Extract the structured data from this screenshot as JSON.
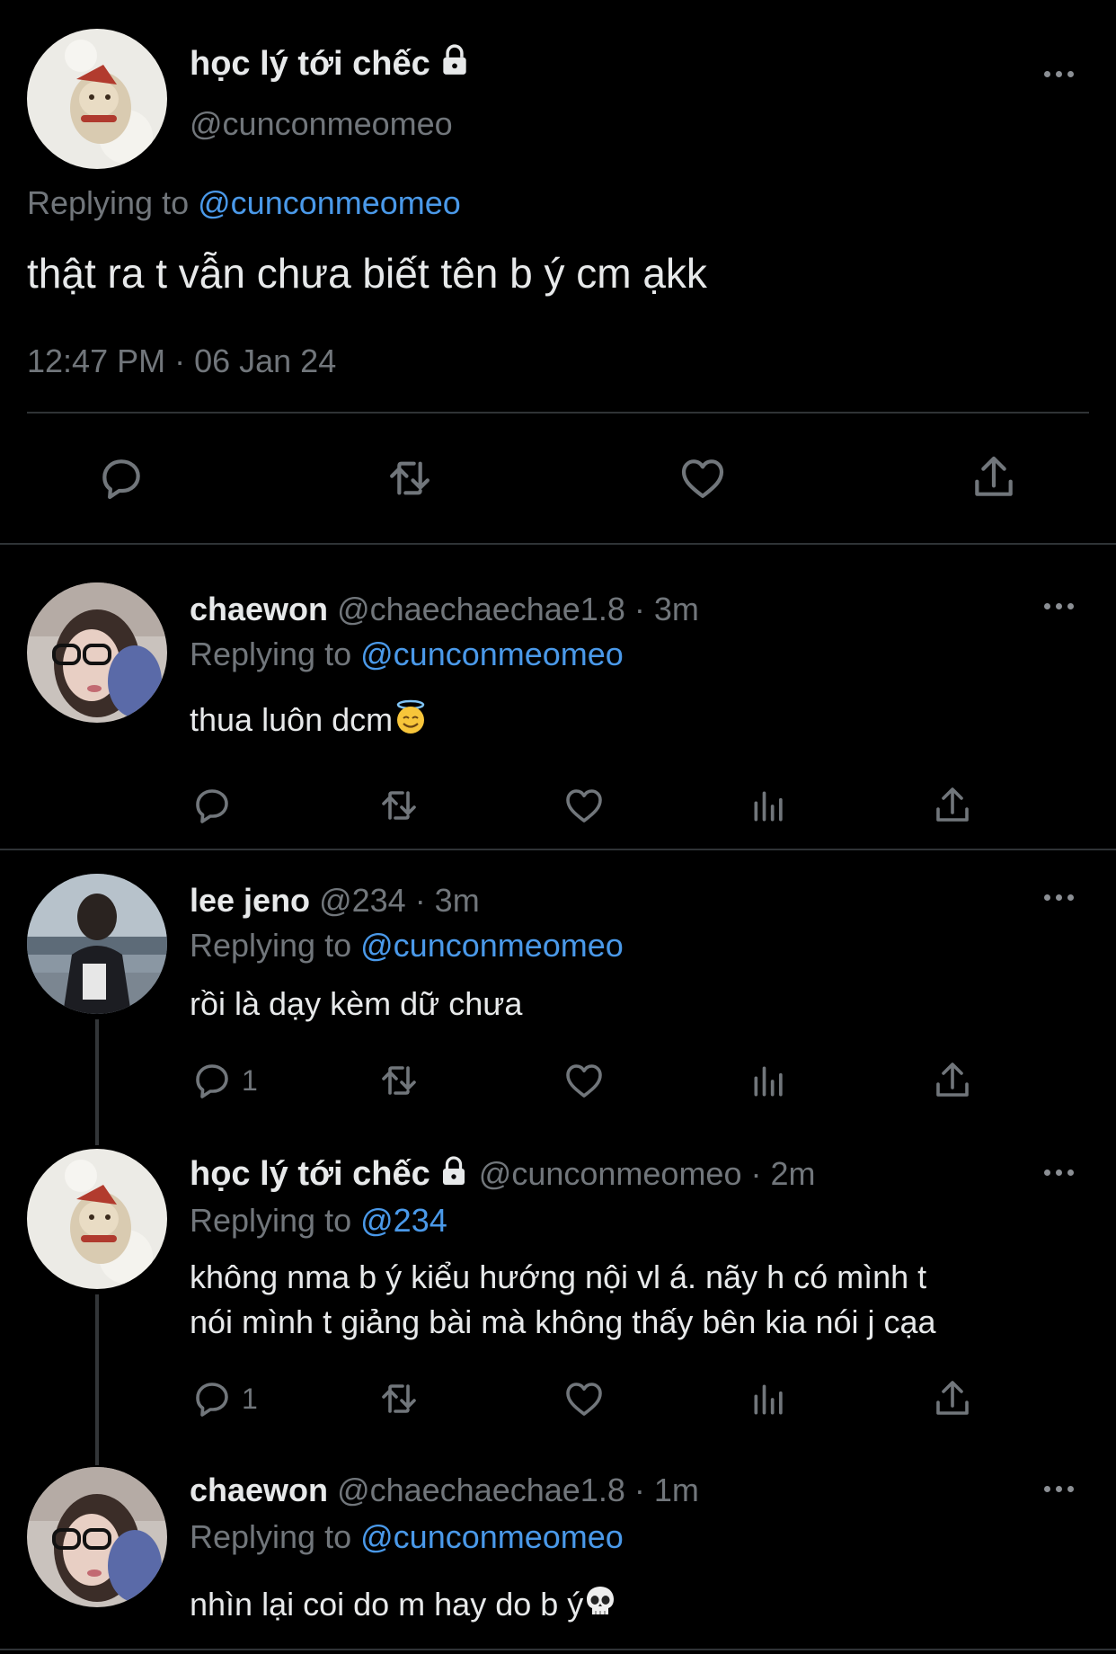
{
  "main_tweet": {
    "display_name": "học lý tới chếc",
    "handle": "@cunconmeomeo",
    "replying_label": "Replying to",
    "replying_to": "@cunconmeomeo",
    "text": "thật ra t vẫn chưa biết tên b ý cm ạkk",
    "timestamp": "12:47 PM · 06 Jan 24"
  },
  "replies": [
    {
      "display_name": "chaewon",
      "meta": "@chaechaechae1.8 · 3m",
      "replying_label": "Replying to",
      "replying_to": "@cunconmeomeo",
      "text": "thua luôn dcm"
    },
    {
      "display_name": "lee jeno",
      "meta": "@234 · 3m",
      "replying_label": "Replying to",
      "replying_to": "@cunconmeomeo",
      "text": "rồi là dạy kèm dữ chưa",
      "reply_count": "1"
    },
    {
      "display_name": "học lý tới chếc",
      "meta": "@cunconmeomeo · 2m",
      "replying_label": "Replying to",
      "replying_to": "@234",
      "text_line1": "không nma b ý kiểu hướng nội vl á. nãy h có mình t",
      "text_line2": "nói mình t giảng bài mà không thấy bên kia nói j cạa",
      "reply_count": "1"
    },
    {
      "display_name": "chaewon",
      "meta": "@chaechaechae1.8 · 1m",
      "replying_label": "Replying to",
      "replying_to": "@cunconmeomeo",
      "text": "nhìn lại coi do m hay do b ý"
    }
  ],
  "icons": {
    "reply": "reply-icon",
    "retweet": "retweet-icon",
    "like": "like-icon",
    "views": "views-icon",
    "share": "share-icon",
    "lock": "lock-icon",
    "more": "more-icon",
    "emoji_halo": "smiling-face-with-halo-icon",
    "emoji_skull": "skull-icon"
  },
  "colors": {
    "background": "#000000",
    "text": "#e7e9ea",
    "secondary": "#71767b",
    "link": "#4a99e9",
    "divider": "#2f3336"
  }
}
